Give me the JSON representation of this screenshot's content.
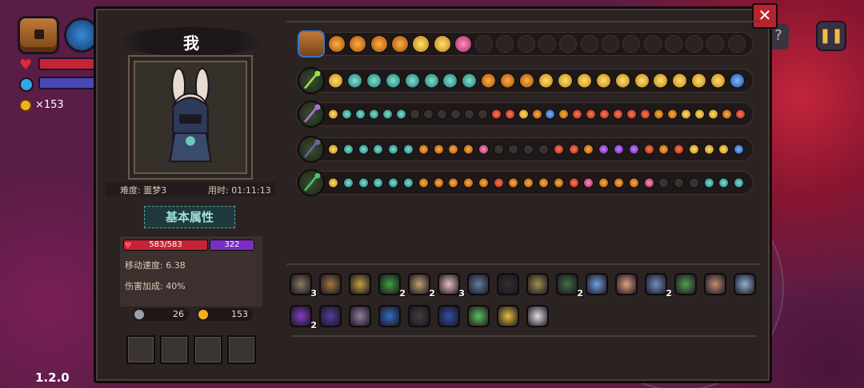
{
  "hud": {
    "coins": "×153",
    "version": "1.2.0",
    "pause_icon": "pause-icon",
    "close_icon": "close-icon",
    "colors": {
      "hp": "#c42436",
      "mp": "#4848b8",
      "accent": "#e8c04a"
    }
  },
  "character": {
    "name": "我",
    "difficulty": "难度: 噩梦3",
    "time": "用时: 01:11:13",
    "attributes_button": "基本属性",
    "hp": "583/583",
    "mp": "322",
    "move_speed": "移动速度: 6.38",
    "damage_bonus": "伤害加成: 40%",
    "keys": "26",
    "coins": "153",
    "slots": 4
  },
  "weapons": [
    {
      "name": "chest",
      "icon": "chest-icon"
    },
    {
      "name": "staff-green",
      "icon": "green-staff-icon"
    },
    {
      "name": "staff-purple",
      "icon": "purple-staff-icon"
    },
    {
      "name": "staff-dark",
      "icon": "dark-staff-icon"
    },
    {
      "name": "staff-emerald",
      "icon": "emerald-staff-icon"
    }
  ],
  "items": [
    {
      "icon": "hat-icon",
      "count": "3"
    },
    {
      "icon": "pouch-icon",
      "count": ""
    },
    {
      "icon": "gem-frame-icon",
      "count": ""
    },
    {
      "icon": "green-claw-icon",
      "count": "2"
    },
    {
      "icon": "antler-icon",
      "count": "2"
    },
    {
      "icon": "feather-icon",
      "count": "3"
    },
    {
      "icon": "compass-icon",
      "count": ""
    },
    {
      "icon": "dark-orb-icon",
      "count": ""
    },
    {
      "icon": "hook-icon",
      "count": ""
    },
    {
      "icon": "leaf-icon",
      "count": "2"
    },
    {
      "icon": "crystal-icon",
      "count": ""
    },
    {
      "icon": "pig-icon",
      "count": ""
    },
    {
      "icon": "amulet-icon",
      "count": "2"
    },
    {
      "icon": "herb-icon",
      "count": ""
    },
    {
      "icon": "egg-icon",
      "count": ""
    },
    {
      "icon": "key-icon",
      "count": ""
    },
    {
      "icon": "wizard-hat-icon",
      "count": "2"
    },
    {
      "icon": "rune-box-icon",
      "count": ""
    },
    {
      "icon": "bone-icon",
      "count": ""
    },
    {
      "icon": "blue-gem-icon",
      "count": ""
    },
    {
      "icon": "bomb-icon",
      "count": ""
    },
    {
      "icon": "potion-icon",
      "count": ""
    },
    {
      "icon": "sprout-icon",
      "count": ""
    },
    {
      "icon": "bell-icon",
      "count": ""
    },
    {
      "icon": "fangs-icon",
      "count": ""
    }
  ]
}
